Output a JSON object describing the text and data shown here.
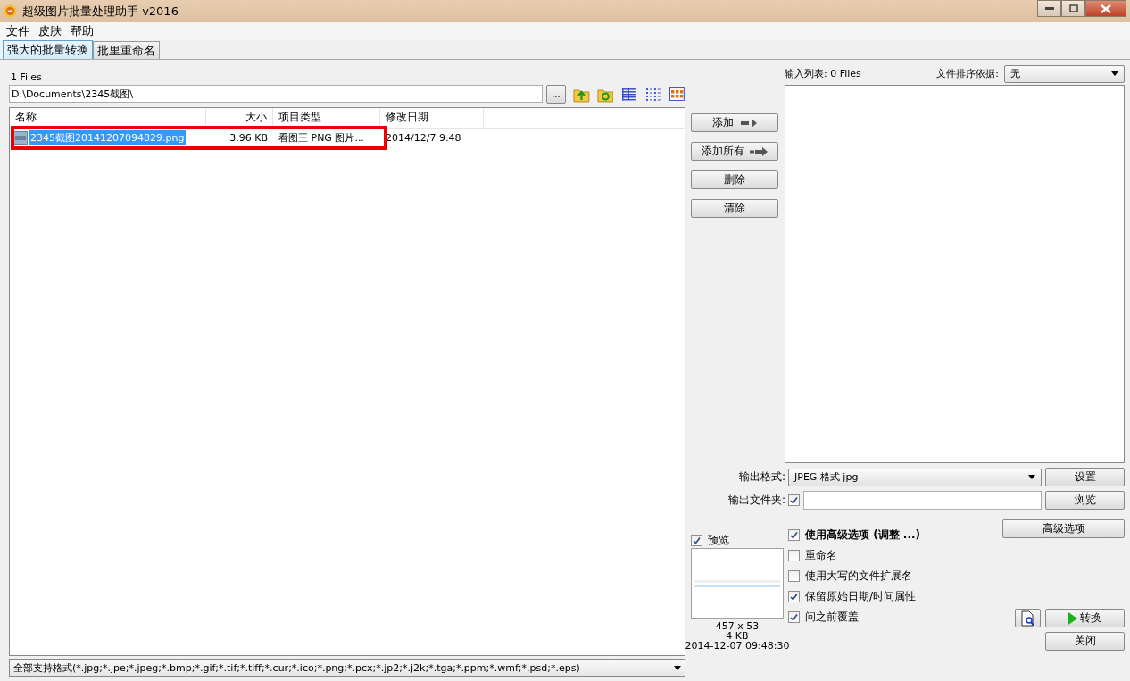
{
  "window": {
    "title": "超级图片批量处理助手  v2016"
  },
  "menu": [
    "文件",
    "皮肤",
    "帮助"
  ],
  "tabs": [
    {
      "label": "强大的批量转换",
      "selected": true
    },
    {
      "label": "批里重命名",
      "selected": false
    }
  ],
  "file_count": "1 Files",
  "path": {
    "value": "D:\\Documents\\2345截图\\",
    "browse": "..."
  },
  "columns": [
    "名称",
    "大小",
    "项目类型",
    "修改日期"
  ],
  "files": [
    {
      "name": "2345截图20141207094829.png",
      "size": "3.96 KB",
      "type": "看图王 PNG 图片...",
      "modified": "2014/12/7 9:48",
      "selected": true,
      "annotated": true
    }
  ],
  "filter": "全部支持格式(*.jpg;*.jpe;*.jpeg;*.bmp;*.gif;*.tif;*.tiff;*.cur;*.ico;*.png;*.pcx;*.jp2;*.j2k;*.tga;*.ppm;*.wmf;*.psd;*.eps)",
  "actions": [
    {
      "label": "添加",
      "kind": "arrow"
    },
    {
      "label": "添加所有",
      "kind": "dashed-arrow"
    },
    {
      "label": "删除",
      "kind": "plain"
    },
    {
      "label": "清除",
      "kind": "plain"
    }
  ],
  "input_list": {
    "label": "输入列表:",
    "count": "0 Files"
  },
  "sort": {
    "label": "文件排序依据:",
    "value": "无"
  },
  "output_format": {
    "label": "输出格式:",
    "value": "JPEG 格式 jpg",
    "button": "设置"
  },
  "output_folder": {
    "label": "输出文件夹:",
    "checked": true,
    "button": "浏览"
  },
  "preview": {
    "label": "预览",
    "checked": true,
    "dimensions": "457 x 53",
    "size": "4 KB",
    "date": "2014-12-07 09:48:30"
  },
  "options": [
    {
      "label": "使用高级选项 (调整 ...)",
      "checked": true,
      "bold": true
    },
    {
      "label": "重命名",
      "checked": false,
      "bold": false
    },
    {
      "label": "使用大写的文件扩展名",
      "checked": false,
      "bold": false
    },
    {
      "label": "保留原始日期/时间属性",
      "checked": true,
      "bold": false
    },
    {
      "label": "问之前覆盖",
      "checked": true,
      "bold": false
    }
  ],
  "advanced_button": "高级选项",
  "convert_button": "转换",
  "close_button": "关闭"
}
